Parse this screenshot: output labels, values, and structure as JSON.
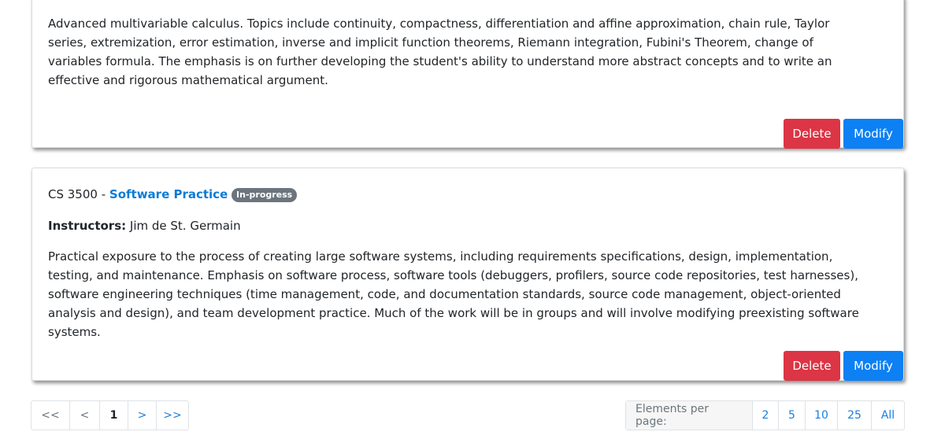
{
  "card1": {
    "description": "Advanced multivariable calculus. Topics include continuity, compactness, differentiation and affine approximation, chain rule, Taylor series, extremization, error estimation, inverse and implicit function theorems, Riemann integration, Fubini's Theorem, change of variables formula. The emphasis is on further developing the student's ability to understand more abstract concepts and to write an effective and rigorous mathematical argument.",
    "delete_label": "Delete",
    "modify_label": "Modify"
  },
  "card2": {
    "course_code": "CS 3500 - ",
    "course_name": "Software Practice",
    "status": "In-progress",
    "instructors_label": "Instructors:",
    "instructors": " Jim de St. Germain",
    "description": "Practical exposure to the process of creating large software systems, including requirements specifications, design, implementation, testing, and maintenance. Emphasis on software process, software tools (debuggers, profilers, source code repositories, test harnesses), software engineering techniques (time management, code, and documentation standards, source code management, object-oriented analysis and design), and team development practice. Much of the work will be in groups and will involve modifying preexisting software systems.",
    "delete_label": "Delete",
    "modify_label": "Modify"
  },
  "pagination": {
    "first": "<<",
    "prev": "<",
    "current": "1",
    "next": ">",
    "last": ">>"
  },
  "page_size": {
    "label": "Elements per page:",
    "options": [
      "2",
      "5",
      "10",
      "25",
      "All"
    ]
  },
  "colors": {
    "delete": "#dc3545",
    "modify": "#0d80f3",
    "badge": "#6c757d",
    "link": "#1a7fe0"
  }
}
